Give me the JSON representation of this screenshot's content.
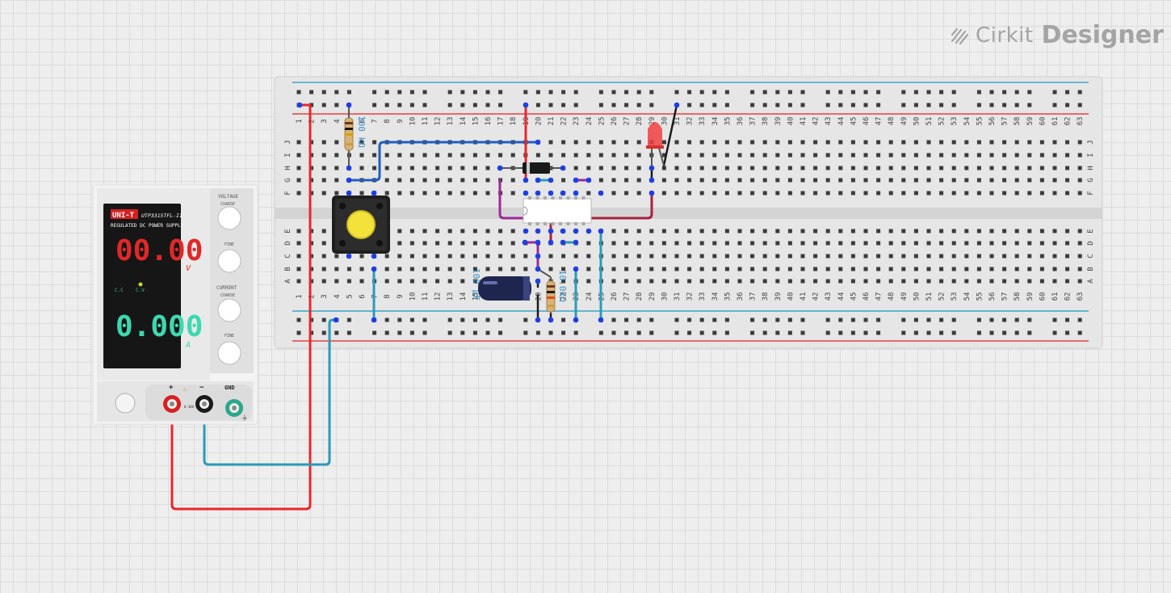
{
  "app": {
    "brand_prefix": "Cirkit",
    "brand_suffix": "Designer"
  },
  "breadboard": {
    "columns": 63,
    "row_letters_top": [
      "J",
      "I",
      "H",
      "G",
      "F"
    ],
    "row_letters_bottom": [
      "E",
      "D",
      "C",
      "B",
      "A"
    ]
  },
  "power_supply": {
    "brand": "UNI-T",
    "model": "UTP3315TFL-II",
    "title": "REGULATED DC POWER SUPPLY",
    "voltage_display": "00.00",
    "voltage_unit": "V",
    "current_display": "0.000",
    "current_unit": "A",
    "cc_label": "C.C",
    "cv_label": "C.V",
    "voltage_label": "VOLTAGE",
    "current_label": "CURRENT",
    "coarse_label": "COARSE",
    "fine_label": "FINE",
    "plus_label": "+",
    "minus_label": "−",
    "gnd_label": "GND",
    "rating_label": "0-30V 0-5A"
  },
  "components": {
    "resistor_top_label": "100 kΩ",
    "resistor_bottom_label": "10.0kΩ",
    "capacitor_label": "100 µF"
  },
  "colors": {
    "red_wire": "#e8262a",
    "blue_wire": "#2a9bb8",
    "navy_wire": "#1f5fbf",
    "purple_wire": "#9b2a9b",
    "maroon_wire": "#a8203f",
    "black_wire": "#1a1a1a",
    "pin_blue": "#1f3fe0"
  }
}
